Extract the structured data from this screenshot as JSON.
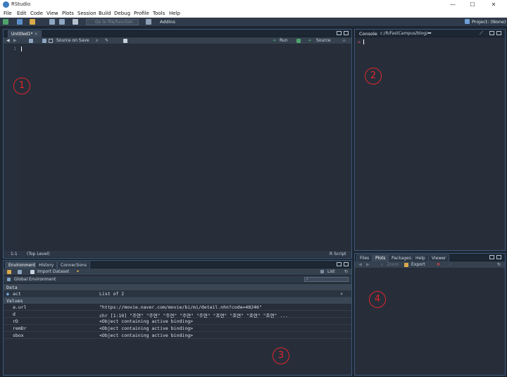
{
  "window": {
    "title": "RStudio",
    "controls": [
      "—",
      "☐",
      "✕"
    ]
  },
  "menu": [
    "File",
    "Edit",
    "Code",
    "View",
    "Plots",
    "Session",
    "Build",
    "Debug",
    "Profile",
    "Tools",
    "Help"
  ],
  "toolbar": {
    "goto_placeholder": "Go to file/function",
    "addins": "Addins",
    "project": "Project: (None)"
  },
  "editor": {
    "tab": "Untitled1*",
    "source_on_save": "Source on Save",
    "run": "Run",
    "source": "Source",
    "line_number": "1",
    "cursor_pos": "1:1",
    "scope": "(Top Level)",
    "file_type": "R Script",
    "annotation": "1"
  },
  "console": {
    "title": "Console",
    "path": "c:/R/FastCampus/blog/",
    "prompt": ">",
    "annotation": "2"
  },
  "environment": {
    "tabs": [
      "Environment",
      "History",
      "Connections"
    ],
    "import_label": "Import Dataset",
    "list_label": "List",
    "scope": "Global Environment",
    "data_header": "Data",
    "values_header": "Values",
    "data_rows": [
      {
        "name": "act",
        "value": "List of 2"
      }
    ],
    "value_rows": [
      {
        "name": "a.url",
        "value": "\"https://movie.naver.com/movie/bi/mi/detail.nhn?code=48246\""
      },
      {
        "name": "d",
        "value": "chr [1:10] \"주연\" \"주연\" \"주연\" \"주연\" \"주연\" \"조연\" \"조연\" \"조연\" \"조연\" ..."
      },
      {
        "name": "rD",
        "value": "<Object containing active binding>"
      },
      {
        "name": "remDr",
        "value": "<Object containing active binding>"
      },
      {
        "name": "sbox",
        "value": "<Object containing active binding>"
      }
    ],
    "annotation": "3"
  },
  "files": {
    "tabs": [
      "Files",
      "Plots",
      "Packages",
      "Help",
      "Viewer"
    ],
    "zoom": "Zoom",
    "export": "Export",
    "annotation": "4"
  }
}
